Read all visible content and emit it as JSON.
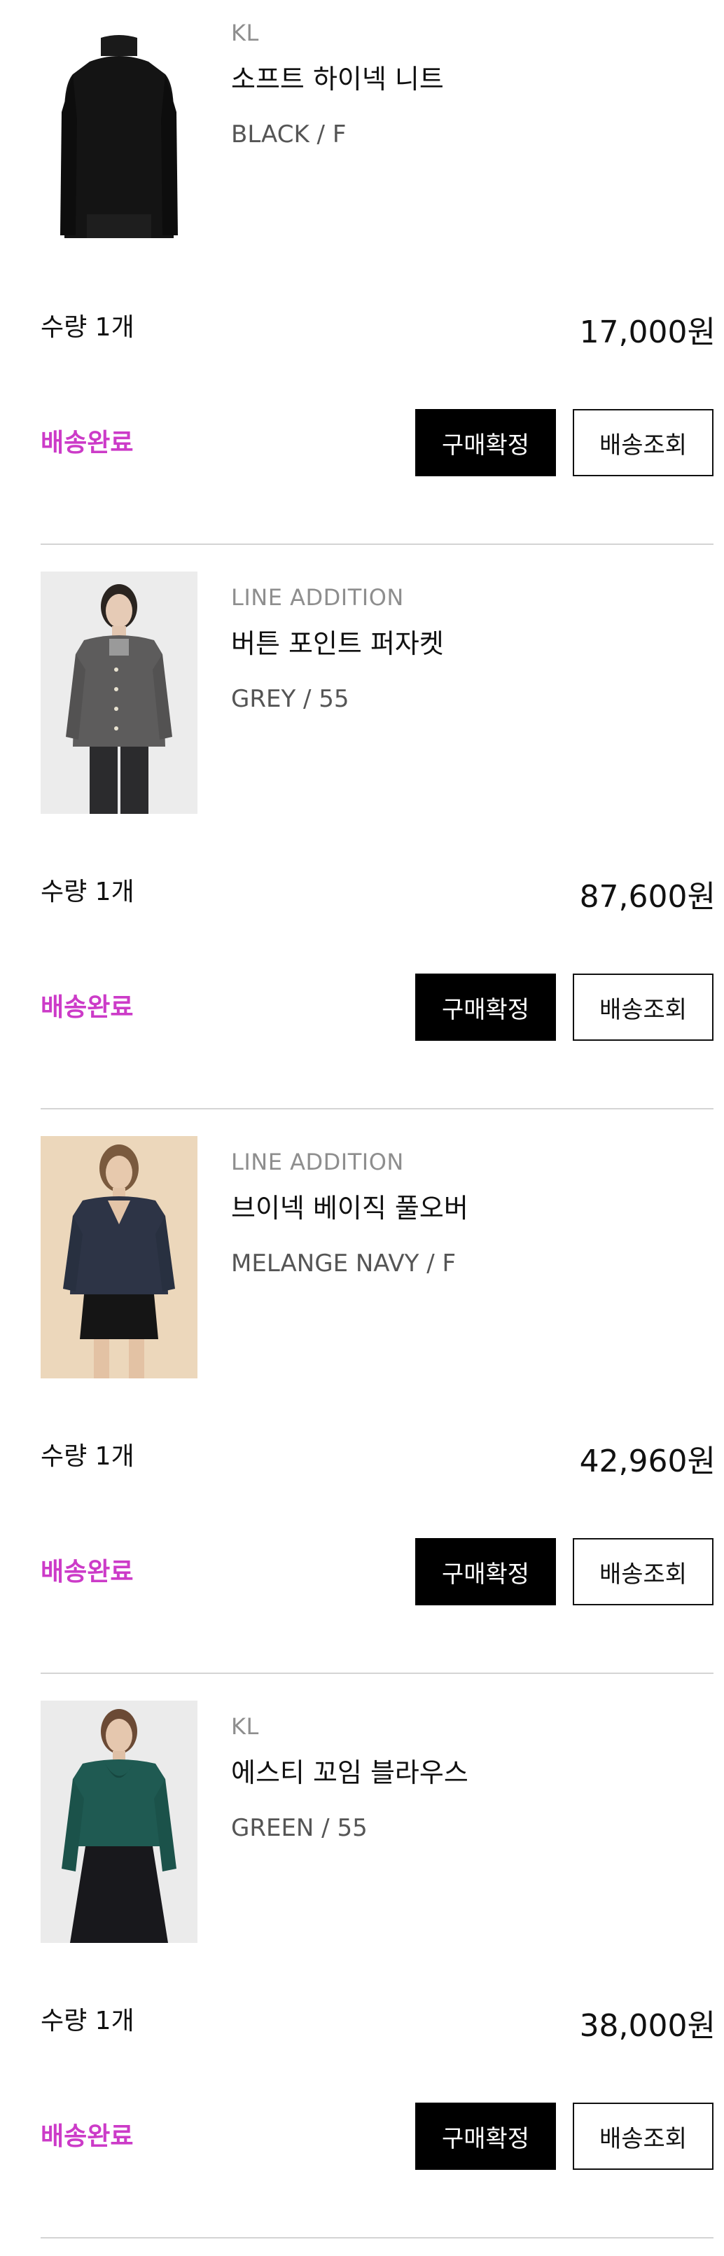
{
  "orders": [
    {
      "brand": "KL",
      "name": "소프트 하이넥 니트",
      "option": "BLACK / F",
      "quantity": "수량 1개",
      "price": "17,000원",
      "status": "배송완료",
      "confirm_label": "구매확정",
      "track_label": "배송조회"
    },
    {
      "brand": "LINE ADDITION",
      "name": "버튼 포인트 퍼자켓",
      "option": "GREY / 55",
      "quantity": "수량 1개",
      "price": "87,600원",
      "status": "배송완료",
      "confirm_label": "구매확정",
      "track_label": "배송조회"
    },
    {
      "brand": "LINE ADDITION",
      "name": "브이넥 베이직 풀오버",
      "option": "MELANGE NAVY / F",
      "quantity": "수량 1개",
      "price": "42,960원",
      "status": "배송완료",
      "confirm_label": "구매확정",
      "track_label": "배송조회"
    },
    {
      "brand": "KL",
      "name": "에스티 꼬임 블라우스",
      "option": "GREEN / 55",
      "quantity": "수량 1개",
      "price": "38,000원",
      "status": "배송완료",
      "confirm_label": "구매확정",
      "track_label": "배송조회"
    }
  ],
  "colors": {
    "status": "#cc3bc8",
    "confirm_bg": "#000000",
    "divider": "#d4d4d4"
  }
}
